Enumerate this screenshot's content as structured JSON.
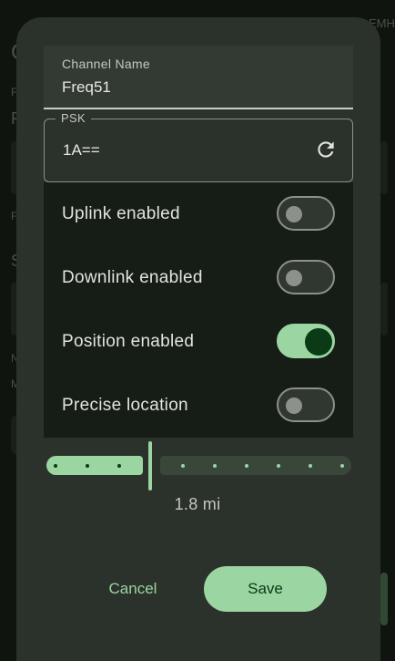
{
  "background": {
    "corner_text": "ЕМН",
    "letters": [
      "C",
      "F",
      "F",
      "F",
      "S",
      "N",
      "M"
    ]
  },
  "dialog": {
    "channel_name": {
      "label": "Channel Name",
      "value": "Freq51"
    },
    "psk": {
      "label": "PSK",
      "value": "1A==",
      "action_icon": "refresh-icon"
    },
    "toggles": [
      {
        "label": "Uplink enabled",
        "enabled": false
      },
      {
        "label": "Downlink enabled",
        "enabled": false
      },
      {
        "label": "Position enabled",
        "enabled": true
      },
      {
        "label": "Precise location",
        "enabled": false
      }
    ],
    "precision_slider": {
      "value_text": "1.8 mi",
      "step_index": 3,
      "total_steps": 10
    },
    "buttons": {
      "cancel": "Cancel",
      "save": "Save"
    }
  },
  "colors": {
    "accent": "#9bd5a1",
    "on_accent": "#0a3a16",
    "dialog_bg": "#2b312b",
    "toggle_section_bg": "#161c16"
  }
}
